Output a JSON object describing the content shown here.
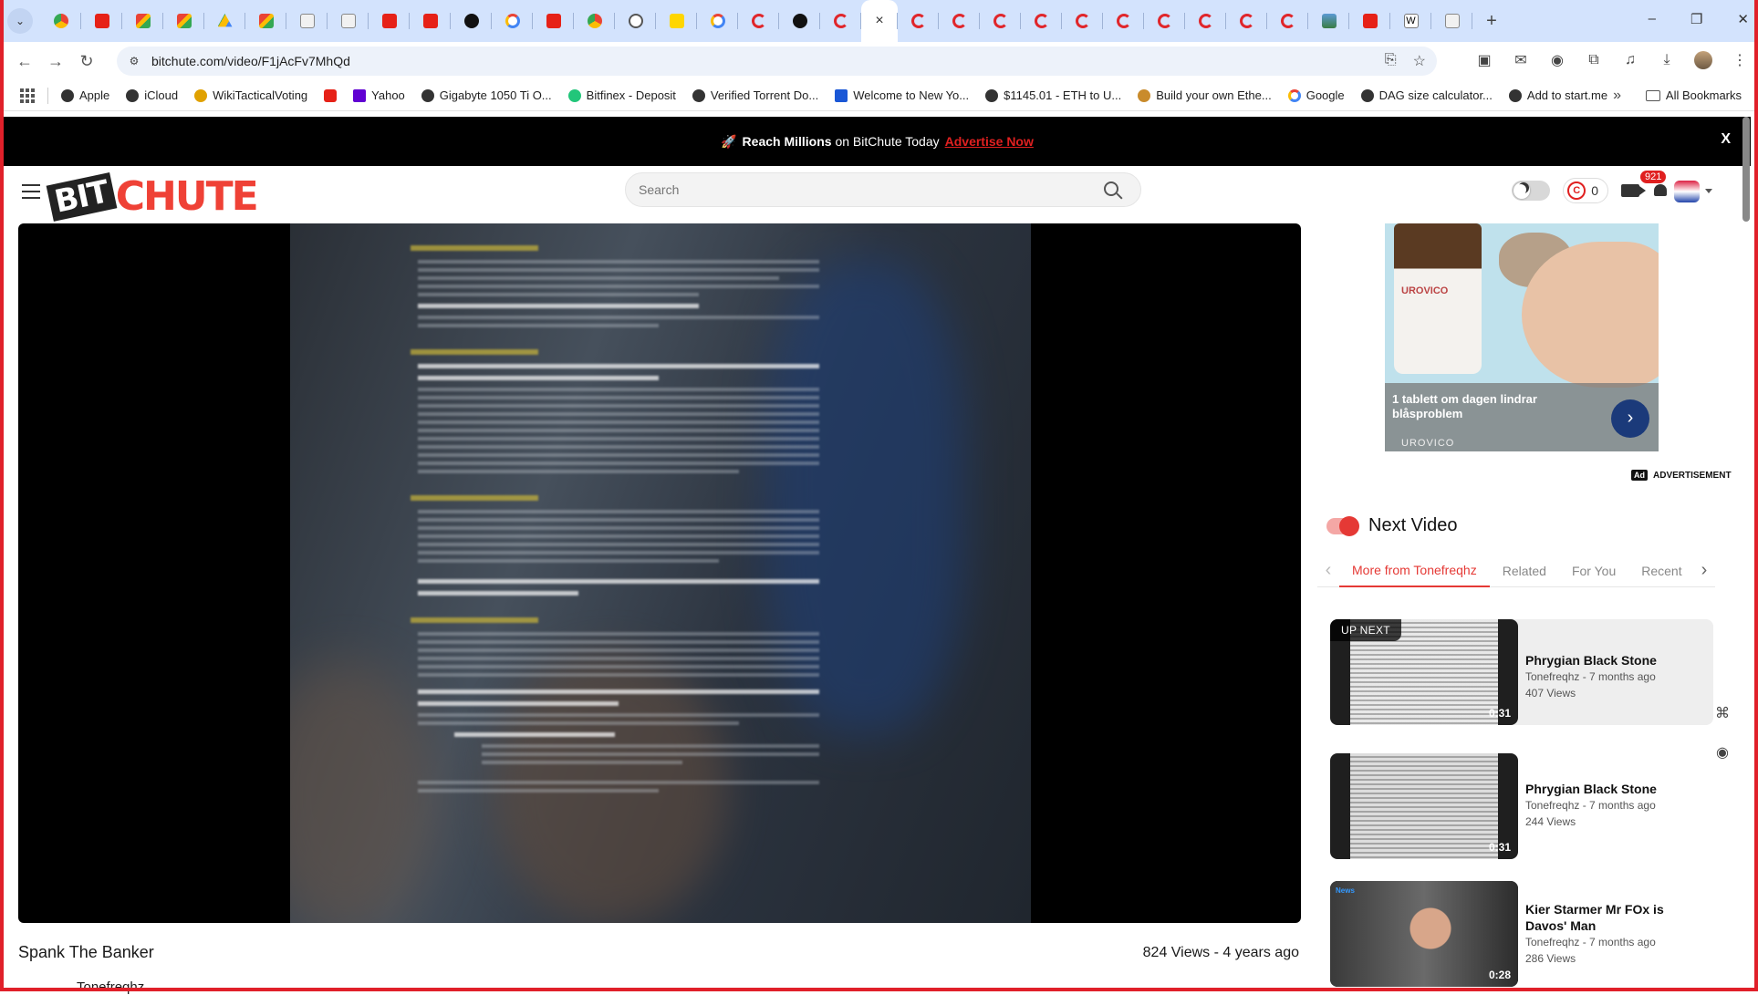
{
  "browser": {
    "active_tab_close": "×",
    "new_tab": "+",
    "url": "bitchute.com/video/F1jAcFv7MhQd",
    "window_controls": [
      "–",
      "❐",
      "✕"
    ],
    "bookmarks": [
      {
        "label": "Apple",
        "icon": "dark"
      },
      {
        "label": "iCloud",
        "icon": "dark"
      },
      {
        "label": "WikiTacticalVoting",
        "icon": "gold"
      },
      {
        "label": "",
        "icon": "red"
      },
      {
        "label": "Yahoo",
        "icon": "purple"
      },
      {
        "label": "Gigabyte 1050 Ti O...",
        "icon": "dark"
      },
      {
        "label": "Bitfinex - Deposit",
        "icon": "green"
      },
      {
        "label": "Verified Torrent Do...",
        "icon": "dark"
      },
      {
        "label": "Welcome to New Yo...",
        "icon": "blue"
      },
      {
        "label": "$1145.01 - ETH to U...",
        "icon": "dark"
      },
      {
        "label": "Build your own Ethe...",
        "icon": "orange"
      },
      {
        "label": "Google",
        "icon": "g"
      },
      {
        "label": "DAG size calculator...",
        "icon": "dark"
      },
      {
        "label": "Add to start.me",
        "icon": "dark"
      }
    ],
    "bookmarks_more": "»",
    "all_bookmarks": "All Bookmarks"
  },
  "promo": {
    "reach": "Reach Millions",
    "on_text": " on BitChute Today",
    "advertise": "Advertise Now",
    "close": "X"
  },
  "header": {
    "logo_bit": "BIT",
    "logo_chute": "CHUTE",
    "search_placeholder": "Search",
    "coins": "0",
    "coin_symbol": "C",
    "notifications": "921"
  },
  "video": {
    "title": "Spank The Banker",
    "meta": "824 Views - 4 years ago",
    "channel": "Tonefreqhz"
  },
  "ad": {
    "bottle_label": "UROVICO",
    "caption": "1 tablett om dagen lindrar blåsproblem",
    "brand": "UROVICO",
    "arrow": "›",
    "tag": "Ad",
    "label": "ADVERTISEMENT"
  },
  "sidebar": {
    "next_title": "Next Video",
    "tabs": [
      "More from Tonefreqhz",
      "Related",
      "For You",
      "Recent"
    ],
    "arrow_left": "‹",
    "arrow_right": "›",
    "up_next": "UP NEXT",
    "videos": [
      {
        "title": "Phrygian Black Stone",
        "channel_age": "Tonefreqhz - 7 months ago",
        "views": "407 Views",
        "duration": "0:31"
      },
      {
        "title": "Phrygian Black Stone",
        "channel_age": "Tonefreqhz - 7 months ago",
        "views": "244 Views",
        "duration": "0:31"
      },
      {
        "title": "Kier Starmer Mr FOx is Davos' Man",
        "channel_age": "Tonefreqhz - 7 months ago",
        "views": "286 Views",
        "duration": "0:28",
        "news_tag": "News"
      }
    ]
  }
}
